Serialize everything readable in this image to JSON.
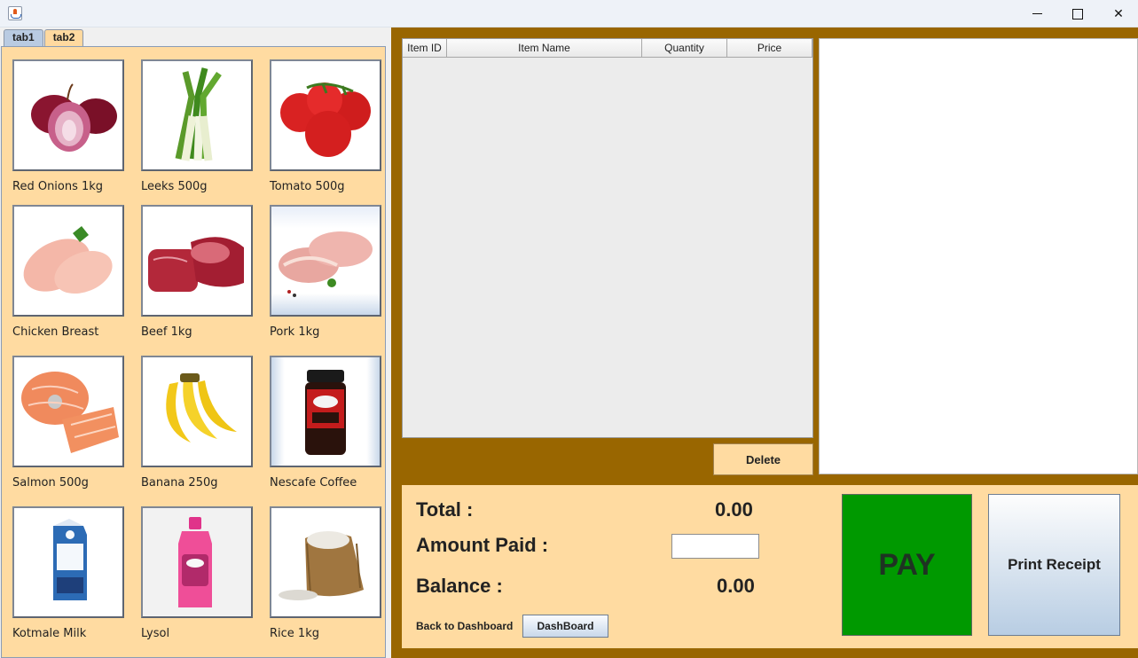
{
  "window": {
    "controls": {
      "minimize": "minimize-icon",
      "maximize": "maximize-icon",
      "close": "✕"
    }
  },
  "tabs": [
    {
      "label": "tab1",
      "active": true
    },
    {
      "label": "tab2",
      "active": false
    }
  ],
  "products": [
    {
      "label": "Red Onions 1kg",
      "icon": "red-onion-image"
    },
    {
      "label": "Leeks 500g",
      "icon": "leeks-image"
    },
    {
      "label": "Tomato 500g",
      "icon": "tomato-image"
    },
    {
      "label": "Chicken Breast",
      "icon": "chicken-breast-image"
    },
    {
      "label": "Beef 1kg",
      "icon": "beef-image"
    },
    {
      "label": " Pork 1kg",
      "icon": "pork-image"
    },
    {
      "label": "Salmon 500g",
      "icon": "salmon-image"
    },
    {
      "label": "Banana 250g",
      "icon": "banana-image"
    },
    {
      "label": "Nescafe Coffee",
      "icon": "nescafe-coffee-image"
    },
    {
      "label": "Kotmale Milk",
      "icon": "kotmale-milk-image"
    },
    {
      "label": "Lysol",
      "icon": "lysol-image"
    },
    {
      "label": "Rice 1kg",
      "icon": "rice-image"
    }
  ],
  "cart_table": {
    "columns": [
      "Item ID",
      "Item Name",
      "Quantity",
      "Price"
    ],
    "rows": []
  },
  "actions": {
    "delete": "Delete",
    "pay": "PAY",
    "print_receipt": "Print Receipt",
    "back_label": "Back to Dashboard",
    "dashboard": "DashBoard"
  },
  "totals": {
    "total_label": "Total :",
    "total_value": "0.00",
    "amount_paid_label": "Amount Paid :",
    "amount_paid_value": "",
    "balance_label": "Balance :",
    "balance_value": "0.00"
  },
  "colors": {
    "panel_bg": "#ffdba1",
    "frame_brown": "#996600",
    "pay_green": "#009900"
  }
}
